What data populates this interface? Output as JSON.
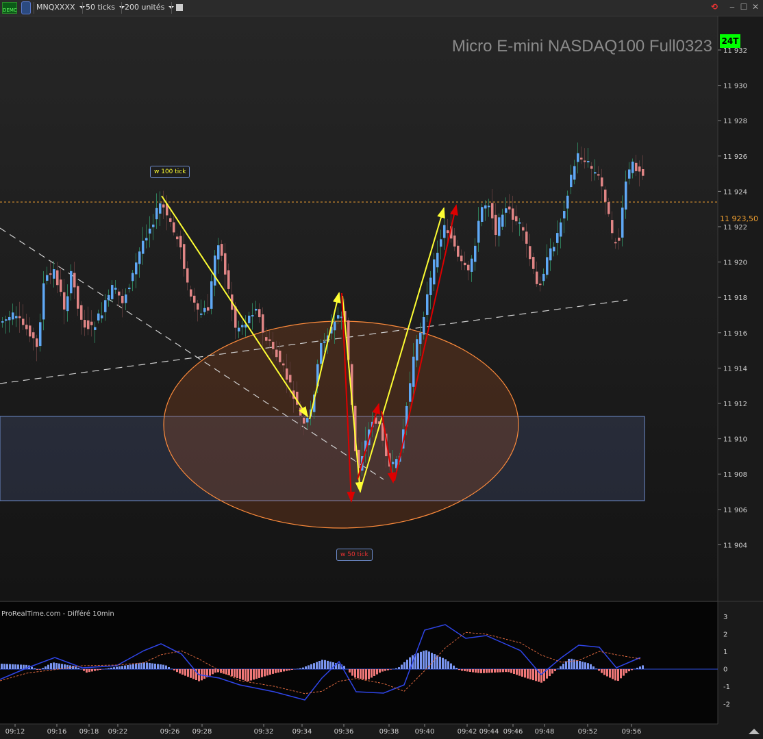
{
  "toolbar": {
    "demo_label": "DEMO",
    "symbol": "MNQXXXX",
    "timeframe": "50 ticks",
    "units": "200 unités"
  },
  "chart": {
    "title": "Micro E-mini NASDAQ100 Full0323",
    "badge": "24T",
    "last_price": "11 923,50",
    "price_ticks": [
      "11 932",
      "11 930",
      "11 928",
      "11 926",
      "11 924",
      "11 922",
      "11 920",
      "11 918",
      "11 916",
      "11 914",
      "11 912",
      "11 910",
      "11 908",
      "11 906",
      "11 904"
    ],
    "time_ticks": [
      "09:12",
      "09:16",
      "09:18",
      "09:22",
      "09:26",
      "09:28",
      "09:32",
      "09:34",
      "09:36",
      "09:38",
      "09:40",
      "09:42",
      "09:44",
      "09:46",
      "09:48",
      "09:52",
      "09:56"
    ],
    "source": "ProRealTime.com - Différé 10min",
    "annotations": {
      "label_100": "w 100 tick",
      "label_50": "w 50 tick"
    },
    "colors": {
      "up": "#5fa8f5",
      "down": "#e08585",
      "yellow": "#ffff33",
      "red": "#dd0000",
      "ellipse": "#ff8c3c",
      "zone": "#6e8ccc",
      "price_line": "#f0a030"
    }
  },
  "indicator": {
    "ticks": [
      "3",
      "2",
      "1",
      "0",
      "-1",
      "-2"
    ]
  }
}
